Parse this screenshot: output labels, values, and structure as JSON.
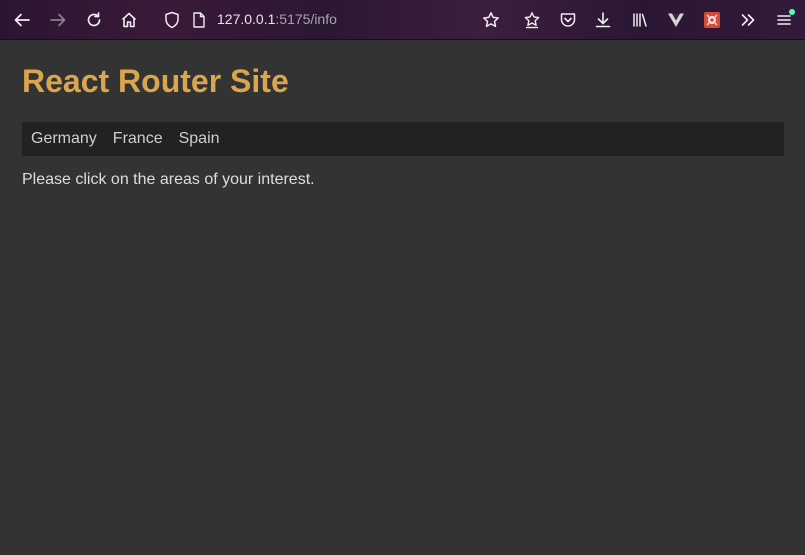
{
  "browser": {
    "url_host": "127.0.0.1",
    "url_rest": ":5175/info",
    "icons": {
      "back": "back-arrow-icon",
      "forward": "forward-arrow-icon",
      "reload": "reload-icon",
      "home": "home-icon",
      "shield": "tracking-protection-shield-icon",
      "page": "page-info-icon",
      "bookmark": "bookmark-star-icon",
      "bookmarks_menu": "bookmarks-star-list-icon",
      "pocket": "pocket-icon",
      "downloads": "downloads-icon",
      "library": "library-icon",
      "vue_devtools": "vue-devtools-icon",
      "extension": "extension-icon",
      "overflow": "overflow-chevrons-icon",
      "menu": "hamburger-menu-icon"
    },
    "colors": {
      "menu_badge": "#54ffbd",
      "extension_bg": "#d84a3a"
    }
  },
  "page": {
    "title": "React Router Site",
    "nav": [
      {
        "label": "Germany"
      },
      {
        "label": "France"
      },
      {
        "label": "Spain"
      }
    ],
    "intro": "Please click on the areas of your interest.",
    "colors": {
      "background": "#333333",
      "title": "#d9a54e",
      "nav_background": "#222222",
      "nav_text": "#cfcfcf"
    }
  }
}
